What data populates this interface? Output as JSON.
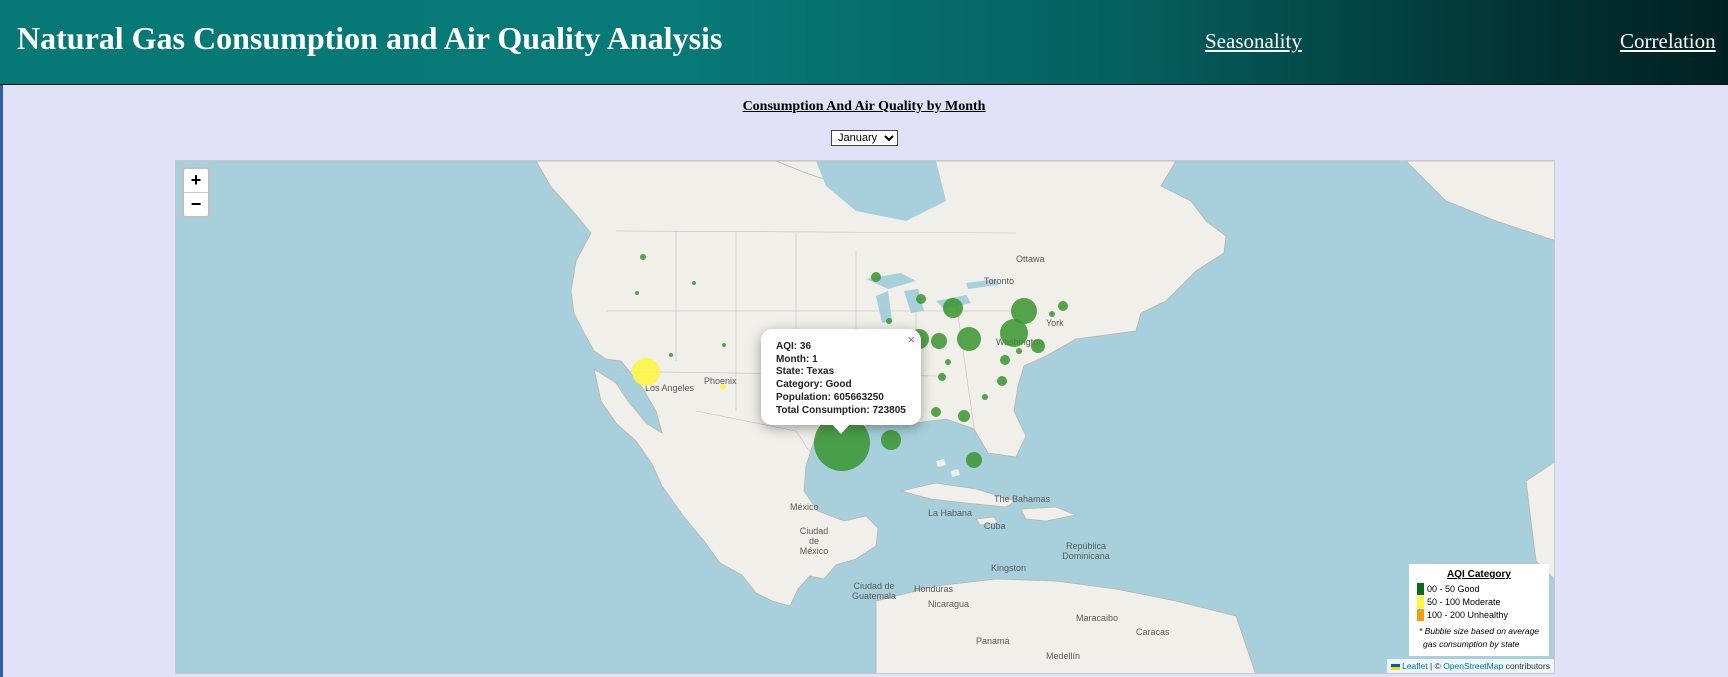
{
  "header": {
    "title": "Natural Gas Consumption and Air Quality Analysis",
    "nav": [
      "Seasonality",
      "Correlation"
    ]
  },
  "section_title": "Consumption And Air Quality by Month",
  "month_select": {
    "selected": "January"
  },
  "map": {
    "zoom_in": "+",
    "zoom_out": "−",
    "labels": {
      "ottawa": "Ottawa",
      "toronto": "Toronto",
      "washington": "Washington",
      "york": "York",
      "phoenix": "Phoenix",
      "los_angeles": "Los Angeles",
      "mexico": "México",
      "ciudad_de_mexico": "Ciudad de México",
      "la_habana": "La Habana",
      "cuba": "Cuba",
      "the_bahamas": "The Bahamas",
      "republica_dominicana": "República Dominicana",
      "kingston": "Kingston",
      "ciudad_de_guatemala": "Ciudad de Guatemala",
      "honduras": "Honduras",
      "nicaragua": "Nicaragua",
      "panama": "Panamá",
      "maracaibo": "Maracaibo",
      "caracas": "Caracas",
      "medellin": "Medellín"
    },
    "colors": {
      "good": "#38952f",
      "moderate": "#fdf542",
      "unhealthy": "#f59c0f",
      "water": "#a7d0dc",
      "land": "#f1efe9"
    }
  },
  "popup": {
    "close": "×",
    "aqi": "AQI: 36",
    "month": "Month: 1",
    "state": "State: Texas",
    "category": "Category: Good",
    "population": "Population: 605663250",
    "total_consumption": "Total Consumption: 723805"
  },
  "legend": {
    "title": "AQI Category",
    "items": [
      {
        "label": "00 - 50 Good",
        "color": "#0b6b1d"
      },
      {
        "label": "50 - 100 Moderate",
        "color": "#fdf542"
      },
      {
        "label": "100 - 200 Unhealthy",
        "color": "#f59c0f"
      }
    ],
    "note_line1": "* Bubble size based on average",
    "note_line2": "gas consumption by state"
  },
  "attribution": {
    "leaflet": "Leaflet",
    "separator": "| ©",
    "osm": "OpenStreetMap",
    "contributors": "contributors"
  }
}
